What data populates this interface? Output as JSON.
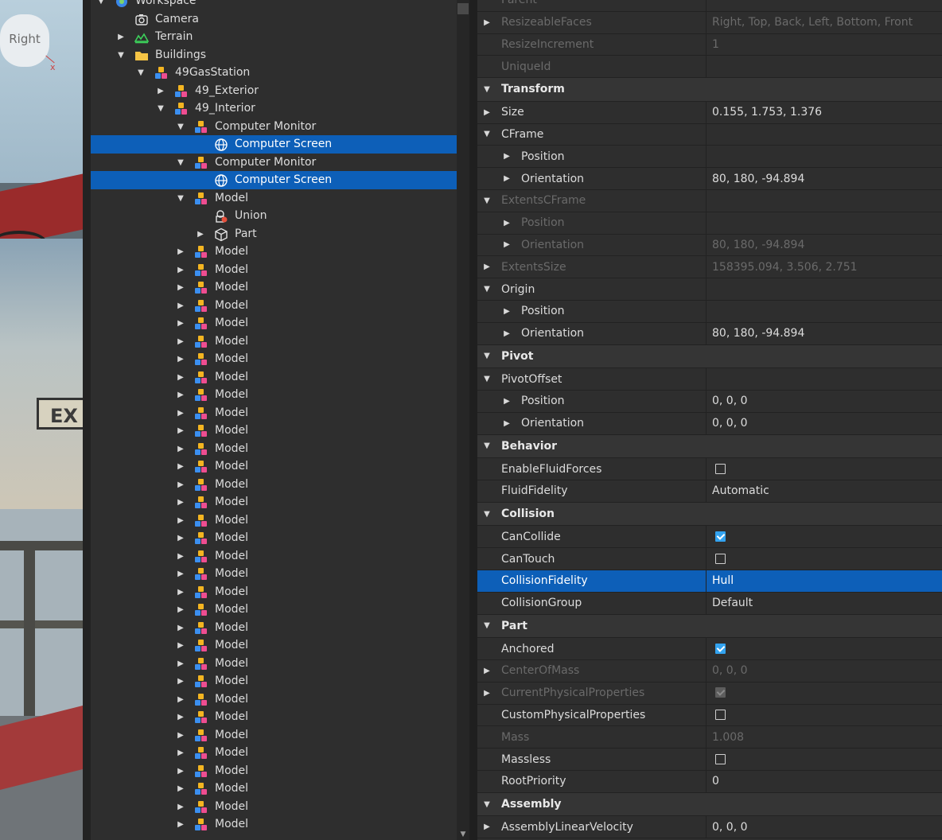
{
  "viewport": {
    "viewcube_face": "Right",
    "axis_label": "x",
    "sign_text": "EX"
  },
  "explorer": {
    "rows": [
      {
        "label": "Workspace",
        "level": 0,
        "arrow": "down",
        "icon": "globe-icon"
      },
      {
        "label": "Camera",
        "level": 1,
        "arrow": "none",
        "icon": "camera-icon"
      },
      {
        "label": "Terrain",
        "level": 1,
        "arrow": "right",
        "icon": "terrain-icon"
      },
      {
        "label": "Buildings",
        "level": 1,
        "arrow": "down",
        "icon": "folder-icon"
      },
      {
        "label": "49GasStation",
        "level": 2,
        "arrow": "down",
        "icon": "model-icon"
      },
      {
        "label": "49_Exterior",
        "level": 3,
        "arrow": "right",
        "icon": "model-icon"
      },
      {
        "label": "49_Interior",
        "level": 3,
        "arrow": "down",
        "icon": "model-icon"
      },
      {
        "label": "Computer Monitor",
        "level": 4,
        "arrow": "down",
        "icon": "model-icon"
      },
      {
        "label": "Computer Screen",
        "level": 5,
        "arrow": "none",
        "icon": "surface-gui-icon",
        "selected": true
      },
      {
        "label": "Computer Monitor",
        "level": 4,
        "arrow": "down",
        "icon": "model-icon"
      },
      {
        "label": "Computer Screen",
        "level": 5,
        "arrow": "none",
        "icon": "surface-gui-icon",
        "selected": true
      },
      {
        "label": "Model",
        "level": 4,
        "arrow": "down",
        "icon": "model-icon"
      },
      {
        "label": "Union",
        "level": 5,
        "arrow": "none",
        "icon": "union-icon"
      },
      {
        "label": "Part",
        "level": 5,
        "arrow": "right",
        "icon": "part-icon"
      },
      {
        "label": "Model",
        "level": 4,
        "arrow": "right",
        "icon": "model-icon"
      },
      {
        "label": "Model",
        "level": 4,
        "arrow": "right",
        "icon": "model-icon"
      },
      {
        "label": "Model",
        "level": 4,
        "arrow": "right",
        "icon": "model-icon"
      },
      {
        "label": "Model",
        "level": 4,
        "arrow": "right",
        "icon": "model-icon"
      },
      {
        "label": "Model",
        "level": 4,
        "arrow": "right",
        "icon": "model-icon"
      },
      {
        "label": "Model",
        "level": 4,
        "arrow": "right",
        "icon": "model-icon"
      },
      {
        "label": "Model",
        "level": 4,
        "arrow": "right",
        "icon": "model-icon"
      },
      {
        "label": "Model",
        "level": 4,
        "arrow": "right",
        "icon": "model-icon"
      },
      {
        "label": "Model",
        "level": 4,
        "arrow": "right",
        "icon": "model-icon"
      },
      {
        "label": "Model",
        "level": 4,
        "arrow": "right",
        "icon": "model-icon"
      },
      {
        "label": "Model",
        "level": 4,
        "arrow": "right",
        "icon": "model-icon"
      },
      {
        "label": "Model",
        "level": 4,
        "arrow": "right",
        "icon": "model-icon"
      },
      {
        "label": "Model",
        "level": 4,
        "arrow": "right",
        "icon": "model-icon"
      },
      {
        "label": "Model",
        "level": 4,
        "arrow": "right",
        "icon": "model-icon"
      },
      {
        "label": "Model",
        "level": 4,
        "arrow": "right",
        "icon": "model-icon"
      },
      {
        "label": "Model",
        "level": 4,
        "arrow": "right",
        "icon": "model-icon"
      },
      {
        "label": "Model",
        "level": 4,
        "arrow": "right",
        "icon": "model-icon"
      },
      {
        "label": "Model",
        "level": 4,
        "arrow": "right",
        "icon": "model-icon"
      },
      {
        "label": "Model",
        "level": 4,
        "arrow": "right",
        "icon": "model-icon"
      },
      {
        "label": "Model",
        "level": 4,
        "arrow": "right",
        "icon": "model-icon"
      },
      {
        "label": "Model",
        "level": 4,
        "arrow": "right",
        "icon": "model-icon"
      },
      {
        "label": "Model",
        "level": 4,
        "arrow": "right",
        "icon": "model-icon"
      },
      {
        "label": "Model",
        "level": 4,
        "arrow": "right",
        "icon": "model-icon"
      },
      {
        "label": "Model",
        "level": 4,
        "arrow": "right",
        "icon": "model-icon"
      },
      {
        "label": "Model",
        "level": 4,
        "arrow": "right",
        "icon": "model-icon"
      },
      {
        "label": "Model",
        "level": 4,
        "arrow": "right",
        "icon": "model-icon"
      },
      {
        "label": "Model",
        "level": 4,
        "arrow": "right",
        "icon": "model-icon"
      },
      {
        "label": "Model",
        "level": 4,
        "arrow": "right",
        "icon": "model-icon"
      },
      {
        "label": "Model",
        "level": 4,
        "arrow": "right",
        "icon": "model-icon"
      },
      {
        "label": "Model",
        "level": 4,
        "arrow": "right",
        "icon": "model-icon"
      },
      {
        "label": "Model",
        "level": 4,
        "arrow": "right",
        "icon": "model-icon"
      },
      {
        "label": "Model",
        "level": 4,
        "arrow": "right",
        "icon": "model-icon"
      },
      {
        "label": "Model",
        "level": 4,
        "arrow": "right",
        "icon": "model-icon"
      }
    ]
  },
  "properties": {
    "rows": [
      {
        "type": "prop",
        "name": "Parent",
        "value": "",
        "level": 1,
        "arrow": "none",
        "disabled": true
      },
      {
        "type": "prop",
        "name": "ResizeableFaces",
        "value": "Right, Top, Back, Left, Bottom, Front",
        "level": 1,
        "arrow": "right",
        "disabled": true
      },
      {
        "type": "prop",
        "name": "ResizeIncrement",
        "value": "1",
        "level": 1,
        "arrow": "none",
        "disabled": true
      },
      {
        "type": "prop",
        "name": "UniqueId",
        "value": "",
        "level": 1,
        "arrow": "none",
        "disabled": true
      },
      {
        "type": "cat",
        "name": "Transform"
      },
      {
        "type": "prop",
        "name": "Size",
        "value": "0.155, 1.753, 1.376",
        "level": 1,
        "arrow": "right"
      },
      {
        "type": "prop",
        "name": "CFrame",
        "value": "",
        "level": 1,
        "arrow": "down"
      },
      {
        "type": "prop",
        "name": "Position",
        "value": "",
        "level": 2,
        "arrow": "right"
      },
      {
        "type": "prop",
        "name": "Orientation",
        "value": "80, 180, -94.894",
        "level": 2,
        "arrow": "right"
      },
      {
        "type": "prop",
        "name": "ExtentsCFrame",
        "value": "",
        "level": 1,
        "arrow": "down",
        "disabled": true
      },
      {
        "type": "prop",
        "name": "Position",
        "value": "",
        "level": 2,
        "arrow": "right",
        "disabled": true
      },
      {
        "type": "prop",
        "name": "Orientation",
        "value": "80, 180, -94.894",
        "level": 2,
        "arrow": "right",
        "disabled": true
      },
      {
        "type": "prop",
        "name": "ExtentsSize",
        "value": "158395.094, 3.506, 2.751",
        "level": 1,
        "arrow": "right",
        "disabled": true
      },
      {
        "type": "prop",
        "name": "Origin",
        "value": "",
        "level": 1,
        "arrow": "down"
      },
      {
        "type": "prop",
        "name": "Position",
        "value": "",
        "level": 2,
        "arrow": "right"
      },
      {
        "type": "prop",
        "name": "Orientation",
        "value": "80, 180, -94.894",
        "level": 2,
        "arrow": "right"
      },
      {
        "type": "cat",
        "name": "Pivot"
      },
      {
        "type": "prop",
        "name": "PivotOffset",
        "value": "",
        "level": 1,
        "arrow": "down"
      },
      {
        "type": "prop",
        "name": "Position",
        "value": "0, 0, 0",
        "level": 2,
        "arrow": "right"
      },
      {
        "type": "prop",
        "name": "Orientation",
        "value": "0, 0, 0",
        "level": 2,
        "arrow": "right"
      },
      {
        "type": "cat",
        "name": "Behavior"
      },
      {
        "type": "prop",
        "name": "EnableFluidForces",
        "checkbox": "unchecked",
        "level": 1,
        "arrow": "none"
      },
      {
        "type": "prop",
        "name": "FluidFidelity",
        "value": "Automatic",
        "level": 1,
        "arrow": "none"
      },
      {
        "type": "cat",
        "name": "Collision"
      },
      {
        "type": "prop",
        "name": "CanCollide",
        "checkbox": "checked",
        "level": 1,
        "arrow": "none"
      },
      {
        "type": "prop",
        "name": "CanTouch",
        "checkbox": "unchecked",
        "level": 1,
        "arrow": "none"
      },
      {
        "type": "prop",
        "name": "CollisionFidelity",
        "value": "Hull",
        "level": 1,
        "arrow": "none",
        "selected": true
      },
      {
        "type": "prop",
        "name": "CollisionGroup",
        "value": "Default",
        "level": 1,
        "arrow": "none"
      },
      {
        "type": "cat",
        "name": "Part"
      },
      {
        "type": "prop",
        "name": "Anchored",
        "checkbox": "checked",
        "level": 1,
        "arrow": "none"
      },
      {
        "type": "prop",
        "name": "CenterOfMass",
        "value": "0, 0, 0",
        "level": 1,
        "arrow": "right",
        "disabled": true
      },
      {
        "type": "prop",
        "name": "CurrentPhysicalProperties",
        "checkbox": "checked-disabled",
        "level": 1,
        "arrow": "right",
        "disabled": true
      },
      {
        "type": "prop",
        "name": "CustomPhysicalProperties",
        "checkbox": "unchecked",
        "level": 1,
        "arrow": "none"
      },
      {
        "type": "prop",
        "name": "Mass",
        "value": "1.008",
        "level": 1,
        "arrow": "none",
        "disabled": true
      },
      {
        "type": "prop",
        "name": "Massless",
        "checkbox": "unchecked",
        "level": 1,
        "arrow": "none"
      },
      {
        "type": "prop",
        "name": "RootPriority",
        "value": "0",
        "level": 1,
        "arrow": "none"
      },
      {
        "type": "cat",
        "name": "Assembly"
      },
      {
        "type": "prop",
        "name": "AssemblyLinearVelocity",
        "value": "0, 0, 0",
        "level": 1,
        "arrow": "right"
      }
    ]
  },
  "colors": {
    "selection": "#0d5fb8",
    "checkbox_on": "#33a3f0",
    "panel_bg": "#2e2e2e",
    "category_bg": "#353535"
  }
}
